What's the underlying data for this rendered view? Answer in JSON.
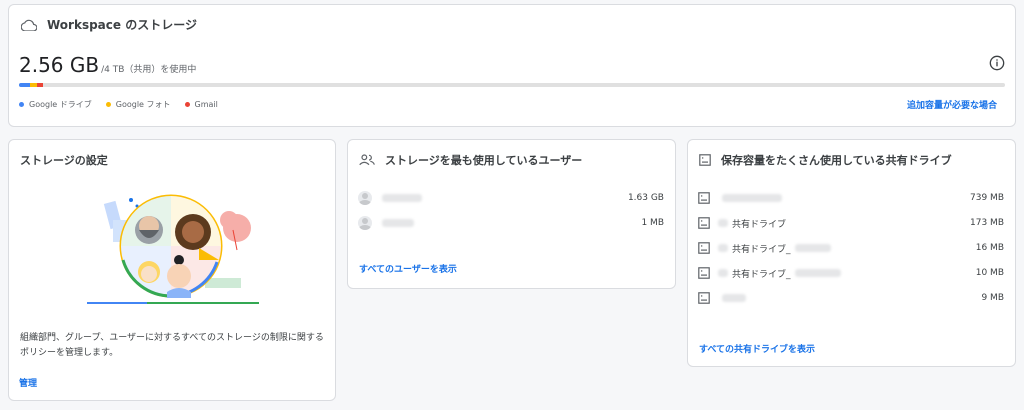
{
  "workspace": {
    "title": "Workspace のストレージ",
    "used": "2.56 GB",
    "total_text": "/4 TB（共用）を使用中",
    "bar_fractions": {
      "drive": 0.011,
      "photos": 0.007,
      "gmail": 0.006
    },
    "legend": [
      {
        "label": "Google ドライブ",
        "color": "#4285f4"
      },
      {
        "label": "Google フォト",
        "color": "#fbbc04"
      },
      {
        "label": "Gmail",
        "color": "#ea4335"
      }
    ],
    "more_link": "追加容量が必要な場合"
  },
  "settings": {
    "title": "ストレージの設定",
    "description": "組織部門、グループ、ユーザーに対するすべてのストレージの制限に関するポリシーを管理します。",
    "manage_link": "管理"
  },
  "users": {
    "title": "ストレージを最も使用しているユーザー",
    "rows": [
      {
        "value": "1.63 GB"
      },
      {
        "value": "1 MB"
      }
    ],
    "view_all": "すべてのユーザーを表示"
  },
  "drives": {
    "title": "保存容量をたくさん使用している共有ドライブ",
    "rows": [
      {
        "name": "",
        "value": "739 MB"
      },
      {
        "name": "共有ドライブ",
        "value": "173 MB"
      },
      {
        "name": "共有ドライブ_",
        "value": "16 MB"
      },
      {
        "name": "共有ドライブ_",
        "value": "10 MB"
      },
      {
        "name": "",
        "value": "9 MB"
      }
    ],
    "view_all": "すべての共有ドライブを表示"
  },
  "icons": {
    "workspace": "cloud-icon",
    "info": "info-icon",
    "users": "people-icon",
    "drives": "shared-drive-icon"
  }
}
